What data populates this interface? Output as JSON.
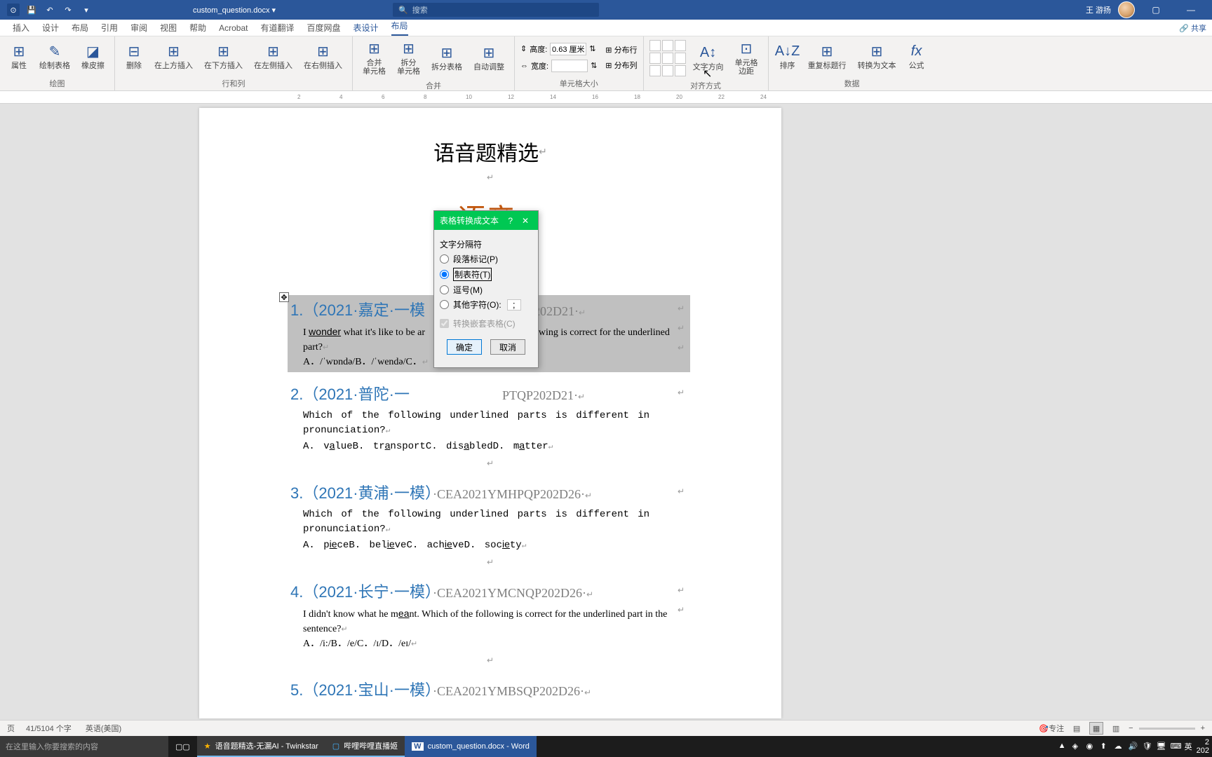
{
  "titlebar": {
    "filename": "custom_question.docx ▾",
    "search_placeholder": "搜索",
    "user": "王 游扬"
  },
  "tabs": [
    "插入",
    "设计",
    "布局",
    "引用",
    "审阅",
    "视图",
    "帮助",
    "Acrobat",
    "有道翻译",
    "百度网盘",
    "表设计",
    "布局"
  ],
  "ribbon": {
    "groups": {
      "draw": {
        "label": "绘图",
        "btns": [
          "属性",
          "绘制表格",
          "橡皮擦"
        ]
      },
      "rowcol": {
        "label": "行和列",
        "btns": [
          "删除",
          "在上方插入",
          "在下方插入",
          "在左侧插入",
          "在右侧插入"
        ]
      },
      "merge": {
        "label": "合并",
        "btns": [
          "合并\n单元格",
          "拆分\n单元格",
          "拆分表格",
          "自动调整"
        ]
      },
      "cellsize": {
        "label": "单元格大小",
        "height_lbl": "高度:",
        "width_lbl": "宽度:",
        "height_val": "0.63 厘米",
        "dist_row": "分布行",
        "dist_col": "分布列"
      },
      "align": {
        "label": "对齐方式",
        "btns": [
          "文字方向",
          "单元格\n边距"
        ]
      },
      "data": {
        "label": "数据",
        "btns": [
          "排序",
          "重复标题行",
          "转换为文本",
          "公式"
        ]
      }
    }
  },
  "doc": {
    "title1": "语音题精选",
    "title2": "语音",
    "q1": {
      "head": "1.（2021·嘉定·一模",
      "code": "QP202D21·",
      "text": "I wonder what it's like to be ar",
      "text2": "ollowing is correct for the underlined part?",
      "opts": "A．/ˈwɒndə/B．/ˈwendə/C．"
    },
    "q2": {
      "head": "2.（2021·普陀·一",
      "code": "PTQP202D21·",
      "text": "Which of the following underlined parts is different in pronunciation?",
      "opts": "A. valueB. transportC. disabledD. matter"
    },
    "q3": {
      "head": "3.（2021·黄浦·一模）",
      "code": "·CEA2021YMHPQP202D26·",
      "text": "Which of the following underlined parts is different in pronunciation?",
      "opts": "A. pieceB. believeC. achieveD. society"
    },
    "q4": {
      "head": "4.（2021·长宁·一模）",
      "code": "·CEA2021YMCNQP202D26·",
      "text": "I didn't know what he meant. Which of the following is correct for the underlined part in the sentence?",
      "opts": "A．/i:/B．/e/C．/ɪ/D．/eɪ/"
    },
    "q5": {
      "head": "5.（2021·宝山·一模）",
      "code": "·CEA2021YMBSQP202D26·"
    }
  },
  "dialog": {
    "title": "表格转换成文本",
    "sec": "文字分隔符",
    "opt1": "段落标记(P)",
    "opt2": "制表符(T)",
    "opt3": "逗号(M)",
    "opt4": "其他字符(O):",
    "char": ";",
    "nested": "转换嵌套表格(C)",
    "ok": "确定",
    "cancel": "取消"
  },
  "statusbar": {
    "page": "页",
    "words": "41/5104 个字",
    "lang": "英语(美国)",
    "focus": "专注"
  },
  "taskbar": {
    "search": "在这里输入你要搜索的内容",
    "task1": "语音题精选-无漏AI - Twinkstar",
    "task2": "哔哩哔哩直播姬",
    "task3": "custom_question.docx - Word",
    "ime": "英",
    "time": "2",
    "date": "202"
  },
  "share": "共享"
}
